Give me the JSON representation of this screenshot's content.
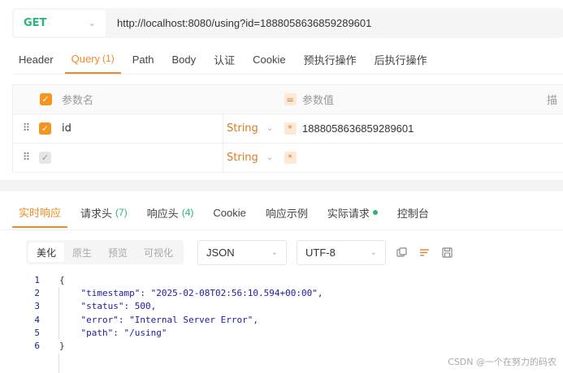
{
  "request": {
    "method": "GET",
    "url": "http://localhost:8080/using?id=1888058636859289601"
  },
  "request_tabs": [
    {
      "label": "Header",
      "count": ""
    },
    {
      "label": "Query",
      "count": "(1)",
      "active": true
    },
    {
      "label": "Path",
      "count": ""
    },
    {
      "label": "Body",
      "count": ""
    },
    {
      "label": "认证",
      "count": ""
    },
    {
      "label": "Cookie",
      "count": ""
    },
    {
      "label": "预执行操作",
      "count": ""
    },
    {
      "label": "后执行操作",
      "count": ""
    }
  ],
  "params": {
    "header_name": "参数名",
    "header_value": "参数值",
    "header_trailing": "描",
    "rows": [
      {
        "name": "id",
        "type": "String",
        "value": "1888058636859289601",
        "checked": true
      },
      {
        "name": "",
        "type": "String",
        "value": "",
        "checked": false
      }
    ],
    "required_mark": "*"
  },
  "response_tabs": [
    {
      "label": "实时响应",
      "count": "",
      "active": true
    },
    {
      "label": "请求头",
      "count": "(7)"
    },
    {
      "label": "响应头",
      "count": "(4)"
    },
    {
      "label": "Cookie",
      "count": ""
    },
    {
      "label": "响应示例",
      "count": ""
    },
    {
      "label": "实际请求",
      "count": "",
      "dot": true
    },
    {
      "label": "控制台",
      "count": ""
    }
  ],
  "format": {
    "buttons": [
      "美化",
      "原生",
      "预览",
      "可视化"
    ],
    "active": "美化",
    "language": "JSON",
    "encoding": "UTF-8"
  },
  "code_lines": [
    {
      "n": "1",
      "text": "{"
    },
    {
      "n": "2",
      "text": "    \"timestamp\": \"2025-02-08T02:56:10.594+00:00\","
    },
    {
      "n": "3",
      "text": "    \"status\": 500,"
    },
    {
      "n": "4",
      "text": "    \"error\": \"Internal Server Error\","
    },
    {
      "n": "5",
      "text": "    \"path\": \"/using\""
    },
    {
      "n": "6",
      "text": "}"
    }
  ],
  "watermark": "CSDN @一个在努力的码农",
  "colors": {
    "accent": "#f08a24",
    "success": "#2bb673",
    "code": "#1a1aa6"
  }
}
